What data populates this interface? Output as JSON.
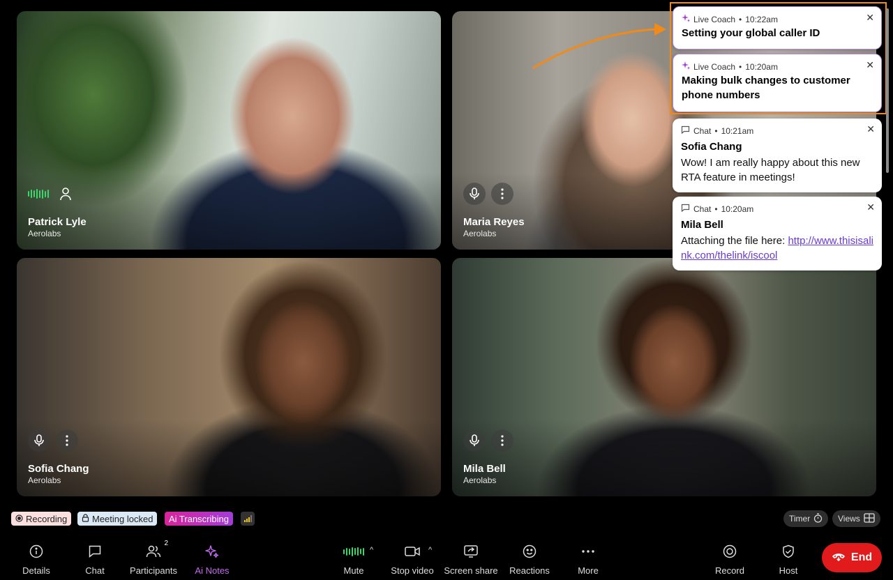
{
  "tiles": [
    {
      "name": "Patrick Lyle",
      "org": "Aerolabs"
    },
    {
      "name": "Maria Reyes",
      "org": "Aerolabs"
    },
    {
      "name": "Sofia Chang",
      "org": "Aerolabs"
    },
    {
      "name": "Mila Bell",
      "org": "Aerolabs"
    }
  ],
  "notifications": [
    {
      "type": "Live Coach",
      "time": "10:22am",
      "title": "Setting your global caller ID"
    },
    {
      "type": "Live Coach",
      "time": "10:20am",
      "title": "Making bulk changes to customer phone numbers"
    },
    {
      "type": "Chat",
      "time": "10:21am",
      "title": "Sofia Chang",
      "body": "Wow! I am really happy about this new RTA feature in meetings!"
    },
    {
      "type": "Chat",
      "time": "10:20am",
      "title": "Mila Bell",
      "body_prefix": "Attaching the file here: ",
      "link": "http://www.thisisalink.com/thelink/iscool"
    }
  ],
  "status": {
    "recording": "Recording",
    "meeting_locked": "Meeting locked",
    "ai_transcribing": "Ai Transcribing",
    "timer": "Timer",
    "views": "Views"
  },
  "toolbar": {
    "details": "Details",
    "chat": "Chat",
    "participants": "Participants",
    "participants_count": "2",
    "ai_notes": "Ai Notes",
    "mute": "Mute",
    "stop_video": "Stop video",
    "screen_share": "Screen share",
    "reactions": "Reactions",
    "more": "More",
    "record": "Record",
    "host": "Host",
    "end": "End"
  },
  "colors": {
    "accent_orange": "#f28a1a",
    "end_red": "#e11b1b",
    "ai_purple": "#a23cd9",
    "speaking_green": "#3dd66b"
  }
}
